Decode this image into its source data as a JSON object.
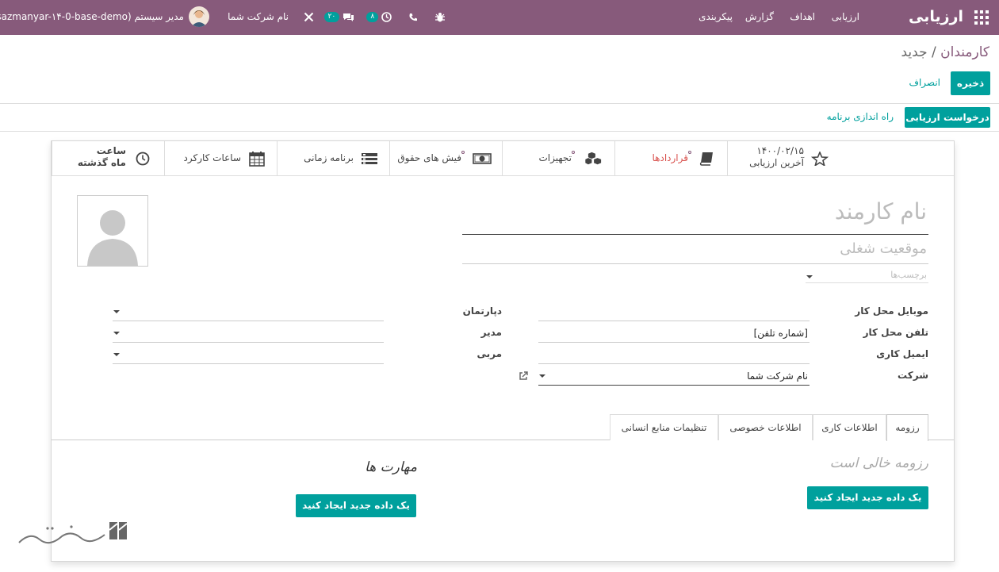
{
  "navbar": {
    "app_title": "ارزیابی",
    "menu": [
      "ارزیابی",
      "اهداف",
      "گزارش",
      "پیکربندی"
    ],
    "activity_count": "۸",
    "messages_count": "۲۰",
    "company": "نام شرکت شما",
    "user": "مدیر سیستم (sazmanyar-۱۴-0-base-demo)"
  },
  "breadcrumb": {
    "parent": "کارمندان",
    "separator": "/",
    "current": "جدید"
  },
  "actions": {
    "save": "ذخیره",
    "discard": "انصراف"
  },
  "header_buttons": {
    "request_appraisal": "درخواست ارزیابی",
    "launch_plan": "راه اندازی برنامه"
  },
  "stats": {
    "last_appraisal_date": "۱۴۰۰/۰۲/۱۵",
    "last_appraisal_label": "آخرین ارزیابی",
    "contracts": "قراردادها",
    "equipment": "تجهیزات",
    "payslips": "فیش های حقوق",
    "schedule": "برنامه زمانی",
    "work_hours": "ساعات کارکرد",
    "hours_line1": "ساعت",
    "hours_line2": "ماه گذشته"
  },
  "form": {
    "name_placeholder": "نام کارمند",
    "job_placeholder": "موقعیت شغلی",
    "tags_placeholder": "برچسب‌ها",
    "labels_right": [
      "موبایل محل کار",
      "تلفن محل کار",
      "ایمیل کاری",
      "شرکت"
    ],
    "values_right": [
      "",
      "[شماره تلفن]",
      "",
      "نام شرکت شما"
    ],
    "labels_left": [
      "دپارتمان",
      "مدیر",
      "مربی"
    ]
  },
  "tabs": [
    "رزومه",
    "اطلاعات کاری",
    "اطلاعات خصوصی",
    "تنظیمات منابع انسانی"
  ],
  "resume": {
    "empty": "رزومه خالی است",
    "create": "یک داده جدید ایجاد کنید"
  },
  "skills": {
    "title": "مهارت ها",
    "create": "یک داده جدید ایجاد کنید"
  },
  "colors": {
    "brand": "#875a7b",
    "accent": "#00a09d"
  }
}
